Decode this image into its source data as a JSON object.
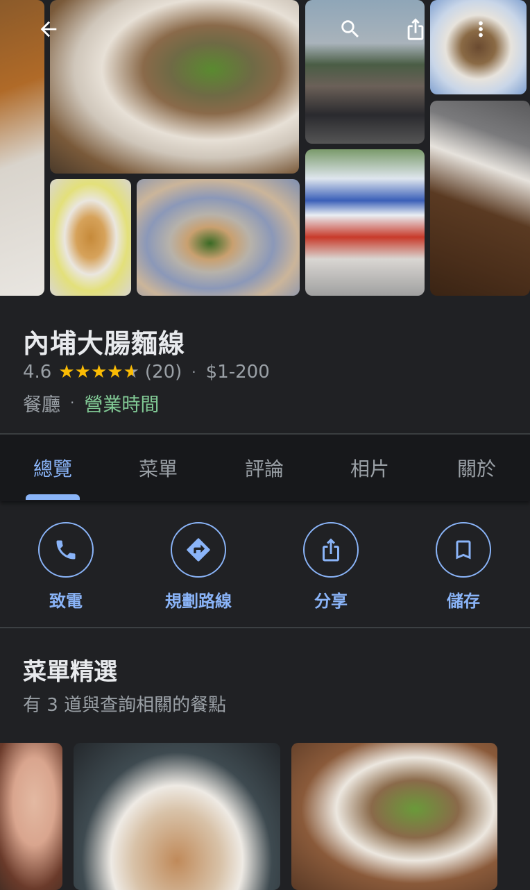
{
  "toolbar": {
    "back_icon": "arrow-back-icon",
    "search_icon": "search-icon",
    "share_icon": "share-icon",
    "more_icon": "more-vert-icon"
  },
  "place": {
    "name": "內埔大腸麵線",
    "rating": "4.6",
    "stars_filled": 4.6,
    "review_count": "(20)",
    "price": "$1-200",
    "category": "餐廳",
    "hours_link": "營業時間"
  },
  "tabs": [
    {
      "label": "總覽"
    },
    {
      "label": "菜單"
    },
    {
      "label": "評論"
    },
    {
      "label": "相片"
    },
    {
      "label": "關於"
    }
  ],
  "actions": [
    {
      "label": "致電",
      "icon": "phone-icon"
    },
    {
      "label": "規劃路線",
      "icon": "directions-icon"
    },
    {
      "label": "分享",
      "icon": "share-icon"
    },
    {
      "label": "儲存",
      "icon": "bookmark-icon"
    }
  ],
  "menu_highlights": {
    "title": "菜單精選",
    "subtitle": "有 3 道與查詢相關的餐點"
  },
  "colors": {
    "background": "#202124",
    "accent": "#8ab4f8",
    "star": "#fbbc04",
    "open_green": "#81c995",
    "secondary_text": "#9aa0a6"
  }
}
